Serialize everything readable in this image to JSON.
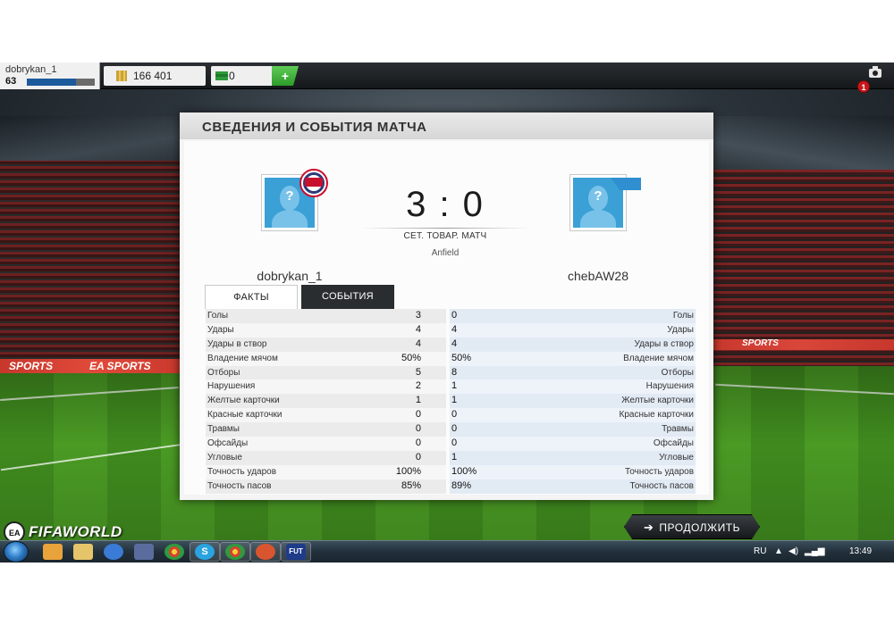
{
  "topbar": {
    "player_name": "dobrykan_1",
    "player_level": "63",
    "xp_progress": 0.72,
    "coins": "166 401",
    "points": "0",
    "add_label": "+",
    "notifications": "1"
  },
  "panel": {
    "title": "СВЕДЕНИЯ И СОБЫТИЯ МАТЧА",
    "home_team": "dobrykan_1",
    "away_team": "chebAW28",
    "score": "3 : 0",
    "match_type": "СЕТ. ТОВАР. МАТЧ",
    "venue": "Anfield",
    "home_badge": "red-bull-badge",
    "away_badge": "club-flag-badge",
    "avatar_placeholder": "?",
    "tabs": [
      {
        "label": "ФАКТЫ",
        "active": true
      },
      {
        "label": "СОБЫТИЯ",
        "active": false
      }
    ],
    "stats": [
      {
        "label": "Голы",
        "home": "3",
        "away": "0"
      },
      {
        "label": "Удары",
        "home": "4",
        "away": "4"
      },
      {
        "label": "Удары в створ",
        "home": "4",
        "away": "4"
      },
      {
        "label": "Владение мячом",
        "home": "50%",
        "away": "50%"
      },
      {
        "label": "Отборы",
        "home": "5",
        "away": "8"
      },
      {
        "label": "Нарушения",
        "home": "2",
        "away": "1"
      },
      {
        "label": "Желтые карточки",
        "home": "1",
        "away": "1"
      },
      {
        "label": "Красные карточки",
        "home": "0",
        "away": "0"
      },
      {
        "label": "Травмы",
        "home": "0",
        "away": "0"
      },
      {
        "label": "Офсайды",
        "home": "0",
        "away": "0"
      },
      {
        "label": "Угловые",
        "home": "0",
        "away": "1"
      },
      {
        "label": "Точность ударов",
        "home": "100%",
        "away": "100%"
      },
      {
        "label": "Точность пасов",
        "home": "85%",
        "away": "89%"
      }
    ]
  },
  "footer": {
    "logo_ea": "EA SPORTS",
    "logo_text": "FIFAWORLD",
    "continue_label": "ПРОДОЛЖИТЬ"
  },
  "background_ads": {
    "left_1": "SPORTS",
    "left_2": "EA SPORTS",
    "right_1": "SPORTS"
  },
  "taskbar": {
    "apps": [
      "media-player-icon",
      "explorer-icon",
      "ie-icon",
      "mail-icon",
      "chrome-icon",
      "skype-icon",
      "chrome-icon",
      "app-icon",
      "fut-icon"
    ],
    "fut_label": "FUT",
    "skype_label": "S",
    "lang": "RU",
    "clock": "13:49"
  },
  "colors": {
    "accent_blue": "#1d5a9c",
    "tab_dark": "#2a2d30",
    "notif_red": "#c8181b",
    "coins_gold": "#caa23a",
    "points_green": "#2e9a3a"
  }
}
